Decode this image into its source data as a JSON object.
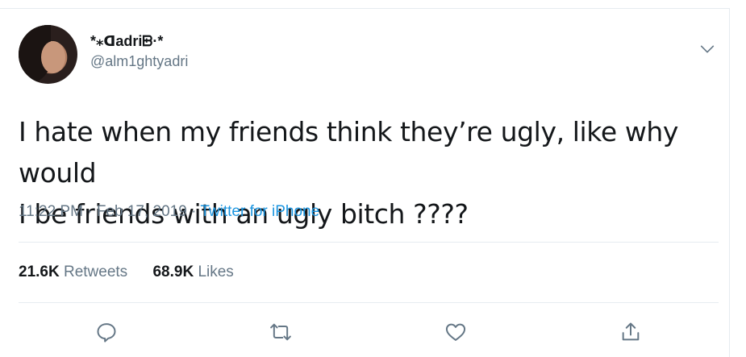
{
  "tweet": {
    "display_name": "*⁎ᗡadriᗸ·*",
    "handle": "@alm1ghtyadri",
    "text_line1": "I hate when my friends think they’re ugly, like why would",
    "text_line2": "I be friends with an ugly bitch ????",
    "time": "11:22 PM",
    "date": "Feb 17, 2019",
    "source": "Twitter for iPhone",
    "separator": " · "
  },
  "stats": {
    "retweets_count": "21.6K",
    "retweets_label": "Retweets",
    "likes_count": "68.9K",
    "likes_label": "Likes"
  },
  "icons": {
    "menu": "chevron-down-icon",
    "reply": "reply-icon",
    "retweet": "retweet-icon",
    "like": "heart-icon",
    "share": "share-icon"
  },
  "colors": {
    "text": "#14171a",
    "muted": "#657786",
    "link": "#1b95e0",
    "divider": "#e6ecf0"
  }
}
